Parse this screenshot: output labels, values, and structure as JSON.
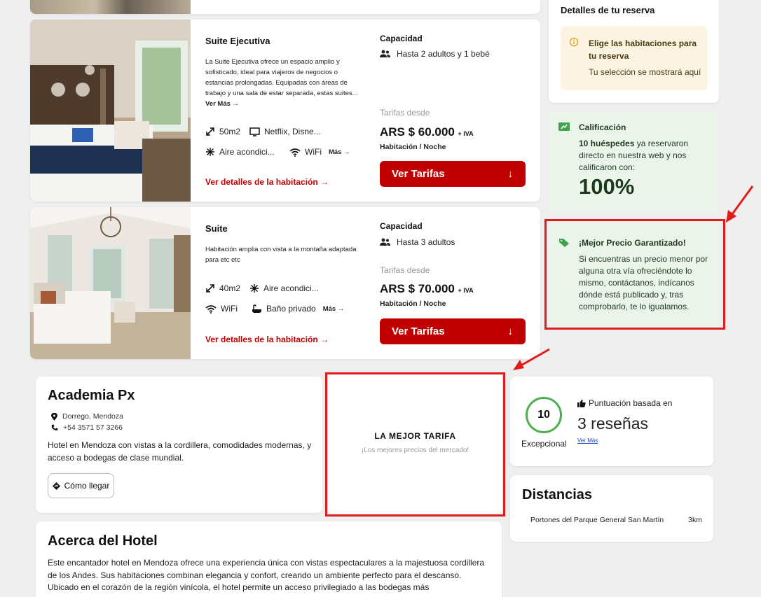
{
  "rooms": [
    {
      "name": "Suite Ejecutiva",
      "description": "La Suite Ejecutiva ofrece un espacio amplio y sofisticado, ideal para viajeros de negocios o estancias prolongadas. Equipadas con áreas de trabajo y una sala de estar separada, estas suites...",
      "more_label": "Ver Más",
      "amenities": [
        "50m2",
        "Netflix, Disne...",
        "Aire acondici...",
        "WiFi"
      ],
      "amenities_more": "Más",
      "details_link": "Ver detalles de la habitación",
      "capacity_label": "Capacidad",
      "capacity": "Hasta 2 adultos y 1 bebé",
      "rate_from": "Tarifas desde",
      "price": "ARS $ 60.000",
      "price_tax": "+ IVA",
      "per_night": "Habitación / Noche",
      "cta": "Ver Tarifas"
    },
    {
      "name": "Suite",
      "description": "Habitación amplia con vista a la montaña adaptada para etc etc",
      "amenities": [
        "40m2",
        "Aire acondici...",
        "WiFi",
        "Baño privado"
      ],
      "amenities_more": "Más",
      "details_link": "Ver detalles de la habitación",
      "capacity_label": "Capacidad",
      "capacity": "Hasta 3 adultos",
      "rate_from": "Tarifas desde",
      "price": "ARS $ 70.000",
      "price_tax": "+ IVA",
      "per_night": "Habitación / Noche",
      "cta": "Ver Tarifas"
    }
  ],
  "reservation": {
    "title": "Detalles de tu reserva",
    "notice_title": "Elige las habitaciones para tu reserva",
    "notice_sub": "Tu selección se mostrará aquí"
  },
  "rating": {
    "title": "Calificación",
    "count": "10 huéspedes",
    "text": "ya reservaron directo en nuestra web y nos calificaron con:",
    "percent": "100%"
  },
  "guarantee": {
    "title": "¡Mejor Precio Garantizado!",
    "text": "Si encuentras un precio menor por alguna otra vía ofreciéndote lo mismo, contáctanos, indícanos dónde está publicado y, tras comprobarlo, te lo igualamos."
  },
  "hotel": {
    "name": "Academia Px",
    "address": "Dorrego, Mendoza",
    "phone": "+54 3571 57 3266",
    "description": "Hotel en Mendoza con vistas a la cordillera, comodidades modernas, y acceso a bodegas de clase mundial.",
    "directions": "Cómo llegar"
  },
  "best_rate": {
    "title": "LA MEJOR TARIFA",
    "subtitle": "¡Los mejores precios del mercado!"
  },
  "score": {
    "value": "10",
    "word": "Excepcional",
    "based_on": "Puntuación basada en",
    "reviews": "3 reseñas",
    "more": "Ver Más"
  },
  "distances": {
    "title": "Distancias",
    "items": [
      {
        "place": "Portones del Parque General San Martín",
        "distance": "3km"
      }
    ]
  },
  "about": {
    "title": "Acerca del Hotel",
    "text": "Este encantador hotel en Mendoza ofrece una experiencia única con vistas espectaculares a la majestuosa cordillera de los Andes. Sus habitaciones combinan elegancia y confort, creando un ambiente perfecto para el descanso. Ubicado en el corazón de la región vinícola, el hotel permite un acceso privilegiado a las bodegas más"
  },
  "colors": {
    "accent": "#c00000",
    "highlight": "#e21b1b",
    "green_bg": "#eaf4ea",
    "notice_bg": "#fdf3e3"
  }
}
